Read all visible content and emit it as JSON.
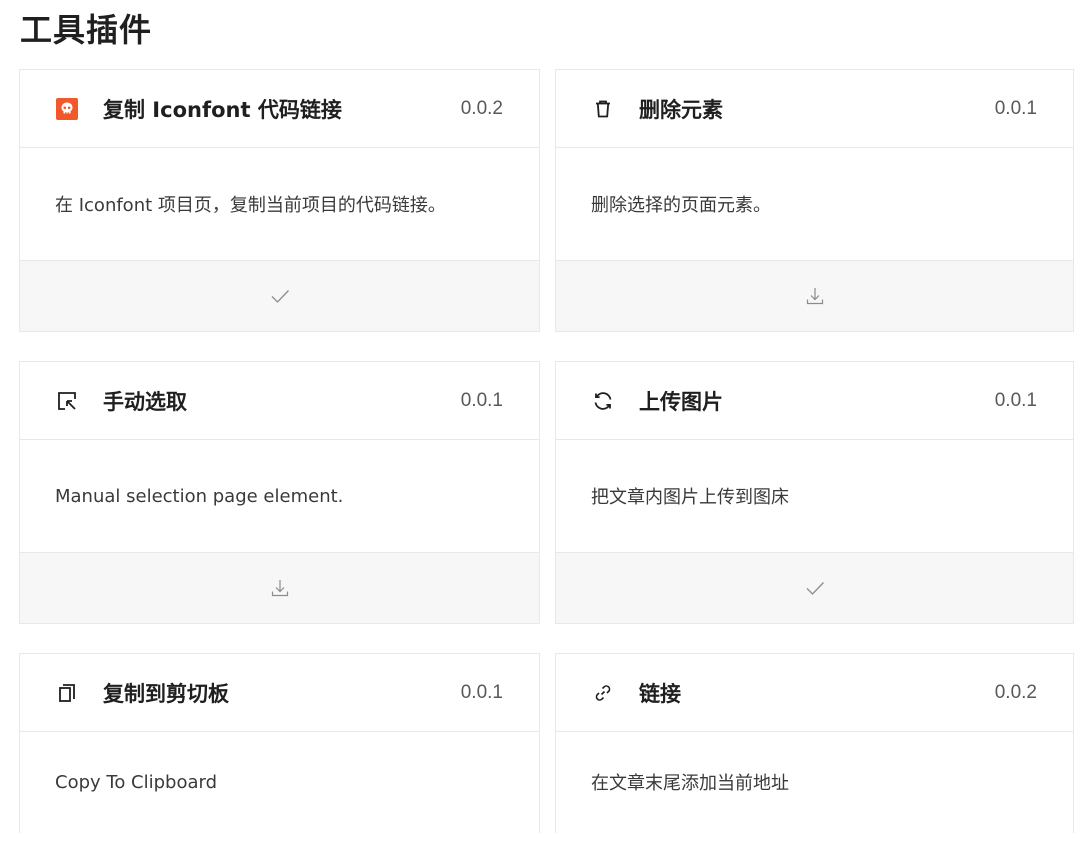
{
  "page": {
    "title": "工具插件"
  },
  "plugins": [
    {
      "title": "复制 Iconfont 代码链接",
      "version": "0.0.2",
      "description": "在 Iconfont 项目页，复制当前项目的代码链接。",
      "icon": "iconfont-logo-icon",
      "icon_color": "#f1592a",
      "action": "installed"
    },
    {
      "title": "删除元素",
      "version": "0.0.1",
      "description": "删除选择的页面元素。",
      "icon": "trash-icon",
      "action": "download"
    },
    {
      "title": "手动选取",
      "version": "0.0.1",
      "description": "Manual selection page element.",
      "icon": "select-cursor-icon",
      "action": "download"
    },
    {
      "title": "上传图片",
      "version": "0.0.1",
      "description": "把文章内图片上传到图床",
      "icon": "sync-icon",
      "action": "installed"
    },
    {
      "title": "复制到剪切板",
      "version": "0.0.1",
      "description": "Copy To Clipboard",
      "icon": "copy-icon"
    },
    {
      "title": "链接",
      "version": "0.0.2",
      "description": "在文章末尾添加当前地址",
      "icon": "link-icon"
    }
  ]
}
